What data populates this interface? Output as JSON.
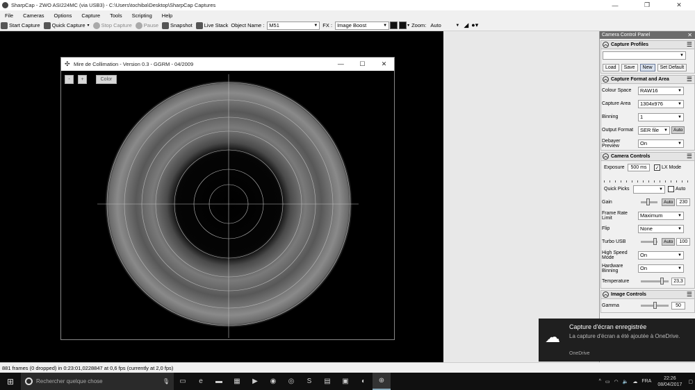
{
  "window": {
    "title": "SharpCap - ZWO ASI224MC (via USB3) - C:\\Users\\tochiba\\Desktop\\SharpCap Captures",
    "minimize": "—",
    "maximize": "❐",
    "close": "✕"
  },
  "menu": [
    "File",
    "Cameras",
    "Options",
    "Capture",
    "Tools",
    "Scripting",
    "Help"
  ],
  "toolbar": {
    "start_capture": "Start Capture",
    "quick_capture": "Quick Capture",
    "stop_capture": "Stop Capture",
    "pause": "Pause",
    "snapshot": "Snapshot",
    "live_stack": "Live Stack",
    "object_name_label": "Object Name :",
    "object_name_value": "M51",
    "fx_label": "FX :",
    "fx_value": "Image Boost",
    "zoom_label": "Zoom:",
    "zoom_value": "Auto"
  },
  "mire": {
    "title": "Mire de Collimation - Version 0.3 - GGRM - 04/2009",
    "minus": "-",
    "plus": "+",
    "color": "Color",
    "minimize": "—",
    "maximize": "☐",
    "close": "✕"
  },
  "panel": {
    "header": "Camera Control Panel",
    "profiles": {
      "title": "Capture Profiles",
      "selected": "",
      "load": "Load",
      "save": "Save",
      "new": "New",
      "set_default": "Set Default"
    },
    "format": {
      "title": "Capture Format and Area",
      "colour_space_label": "Colour Space",
      "colour_space": "RAW16",
      "capture_area_label": "Capture Area",
      "capture_area": "1304x976",
      "binning_label": "Binning",
      "binning": "1",
      "output_format_label": "Output Format",
      "output_format": "SER file",
      "output_auto": "Auto",
      "debayer_label": "Debayer Preview",
      "debayer": "On"
    },
    "controls": {
      "title": "Camera Controls",
      "exposure_label": "Exposure",
      "exposure": "500 ms",
      "lx_mode": "LX Mode",
      "quick_picks_label": "Quick Picks",
      "quick_picks_auto": "Auto",
      "gain_label": "Gain",
      "gain_auto": "Auto",
      "gain": "230",
      "frame_rate_label": "Frame Rate Limit",
      "frame_rate": "Maximum",
      "flip_label": "Flip",
      "flip": "None",
      "turbo_label": "Turbo USB",
      "turbo_auto": "Auto",
      "turbo": "100",
      "high_speed_label": "High Speed Mode",
      "high_speed": "On",
      "hw_binning_label": "Hardware Binning",
      "hw_binning": "On",
      "temperature_label": "Temperature",
      "temperature": "23,3"
    },
    "image": {
      "title": "Image Controls",
      "gamma_label": "Gamma",
      "gamma": "50"
    }
  },
  "status": "881 frames (0 dropped) in 0:23:01,0228847 at 0,6 fps  (currently at 2,0 fps)",
  "toast": {
    "title": "Capture d'écran enregistrée",
    "body": "La capture d'écran a été ajoutée à OneDrive.",
    "source": "OneDrive"
  },
  "taskbar": {
    "search_placeholder": "Rechercher quelque chose",
    "language": "FRA",
    "time": "22:26",
    "date": "08/04/2017"
  }
}
